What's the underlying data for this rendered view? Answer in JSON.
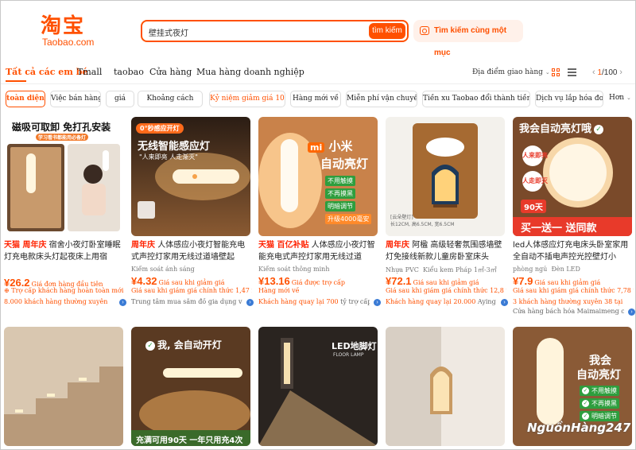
{
  "brand": {
    "logo_cn": "淘宝",
    "logo_en": "Taobao.com",
    "color": "#ff5000"
  },
  "search": {
    "query": "壁挂式夜灯",
    "button": "tìm kiếm",
    "image_search": "Tìm kiếm cùng một mục"
  },
  "tabs": [
    "Tất cả các em bé",
    "Tmall",
    "taobao",
    "Cửa hàng",
    "Mua hàng doanh nghiệp"
  ],
  "toolbar": {
    "ship_to": "Địa điểm giao hàng",
    "page_current": "1",
    "page_total": "/100"
  },
  "filters": [
    "toàn diện",
    "Việc bán hàng",
    "giá",
    "Khoảng cách",
    "Kỷ niệm giảm giá 10%",
    "Hàng mới về",
    "Miễn phí vận chuyển",
    "Tiền xu Taobao đổi thành tiền mặt",
    "Dịch vụ lắp hóa đơn"
  ],
  "filters_more": "Hơn",
  "products": [
    {
      "tag": "天猫 周年庆",
      "title": "宿舍小夜灯卧室睡眠灯充电款床头灯起夜床上用宿",
      "shop": "",
      "price": "¥26.2",
      "price_note": "Giá đơn hàng đầu tiên",
      "note": "Trợ cấp khách hàng hoàn toàn mới",
      "sold": "8.000 khách hàng thường xuyên",
      "shop2": "",
      "overlay": [
        "磁吸可取卸 免打孔安装",
        "学习看书都能用必备灯"
      ]
    },
    {
      "tag": "周年庆",
      "title": "人体感应小夜灯智能充电式声控灯家用无线过道墙壁起",
      "shop": "Kiểm soát ánh sáng",
      "price": "¥4.32",
      "price_note": "Giá sau khi giảm giá",
      "note": "Giá sau khi giảm giá chính thức 1,47 nhân dân tệ",
      "sold": "",
      "shop2": "Trung tâm mua sắm đồ gia dụng và...",
      "overlay": [
        "0°秒感应开灯",
        "无线智能感应灯",
        "\"人来即亮 人走渐灭\""
      ]
    },
    {
      "tag": "天猫 百亿补贴",
      "title": "人体感应小夜灯智能充电式声控灯家用无线过道",
      "shop": "Kiểm soát thông minh",
      "price": "¥13.16",
      "price_note": "Giá được trợ cấp",
      "note": "Hàng mới về",
      "sold": "Khách hàng quay lại 700",
      "shop2": "tỷ trợ cấp",
      "overlay": [
        "mi 小米",
        "自动亮灯",
        "不用触摸",
        "不再摸黑",
        "明暗调节",
        "升级4000毫安"
      ]
    },
    {
      "tag": "周年庆",
      "title": "阿楹 高级轻奢氛围感墙壁灯免接线新款儿童房卧室床头",
      "shop": "Nhựa PVC",
      "price": "¥72.1",
      "price_note": "Giá sau khi giảm giá",
      "note": "Giá sau khi giảm giá chính thức 12,8 tệ",
      "sold": "Khách hàng quay lại 20.000",
      "shop2": "Aying ...",
      "shop_extra": "Kiểu kem Pháp 1㎡-3㎡",
      "overlay": [
        "[云朵壁灯]",
        "长12CM, 高6.5CM, 宽6.5CM"
      ]
    },
    {
      "tag": "",
      "title": "led人体感应灯充电床头卧室家用全自动不插电声控光控壁灯小",
      "shop": "phòng ngủ",
      "shop_extra": "Đèn LED",
      "price": "¥7.9",
      "price_note": "Giá sau khi giảm giá",
      "note": "Giá sau khi giảm giá chính thức 7,78 tệ",
      "sold": "3 khách hàng thường xuyên 38 tại cửa",
      "shop2": "Cửa hàng bách hóa Maimaimeng c...",
      "overlay": [
        "我会自动亮灯哦",
        "人来即亮",
        "人走即灭",
        "90天",
        "买一送一 送同款"
      ]
    }
  ],
  "row2": [
    {
      "overlay": []
    },
    {
      "overlay": [
        "我, 会自动开灯",
        "充满可用90天 一年只用充4次"
      ]
    },
    {
      "overlay": [
        "LED地脚灯",
        "FLOOR LAMP"
      ]
    },
    {
      "overlay": []
    },
    {
      "overlay": [
        "我会",
        "自动亮灯",
        "不用触摸",
        "不再摸黑",
        "明暗调节"
      ]
    }
  ],
  "watermark": "NguồnHàng247"
}
